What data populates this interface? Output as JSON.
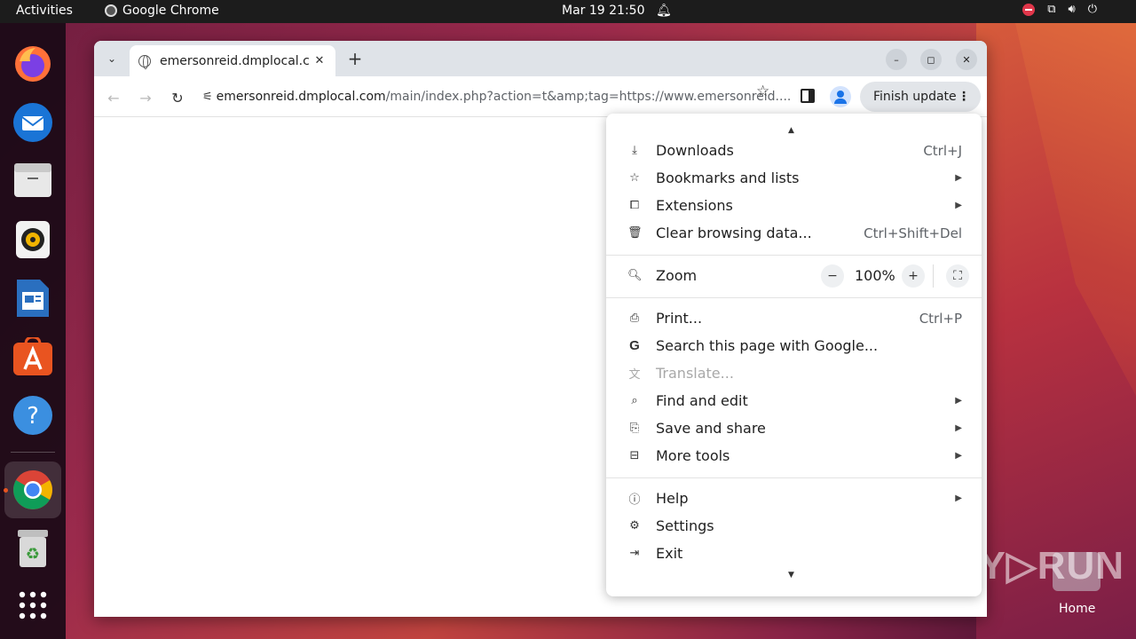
{
  "topbar": {
    "activities": "Activities",
    "app_name": "Google Chrome",
    "clock": "Mar 19  21:50"
  },
  "dock": {
    "items": [
      "firefox-icon",
      "thunderbird-icon",
      "files-icon",
      "rhythmbox-icon",
      "libreoffice-writer-icon",
      "app-center-icon",
      "help-icon",
      "chrome-icon",
      "trash-icon",
      "show-apps-icon"
    ]
  },
  "browser": {
    "tab_title": "emersonreid.dmplocal.c",
    "url_host": "emersonreid.dmplocal.com",
    "url_path": "/main/index.php?action=t&amp;tag=https://www.emersonreid....",
    "finish_update": "Finish update"
  },
  "menu": {
    "items": [
      {
        "icon": "download-icon",
        "label": "Downloads",
        "shortcut": "Ctrl+J"
      },
      {
        "icon": "star-icon",
        "label": "Bookmarks and lists",
        "submenu": true
      },
      {
        "icon": "extensions-icon",
        "label": "Extensions",
        "submenu": true
      },
      {
        "icon": "trash-icon",
        "label": "Clear browsing data...",
        "shortcut": "Ctrl+Shift+Del"
      }
    ],
    "zoom": {
      "label": "Zoom",
      "minus": "−",
      "value": "100%",
      "plus": "+"
    },
    "items2": [
      {
        "icon": "print-icon",
        "label": "Print...",
        "shortcut": "Ctrl+P"
      },
      {
        "icon": "google-icon",
        "label": "Search this page with Google..."
      },
      {
        "icon": "translate-icon",
        "label": "Translate...",
        "disabled": true
      },
      {
        "icon": "find-icon",
        "label": "Find and edit",
        "submenu": true
      },
      {
        "icon": "save-icon",
        "label": "Save and share",
        "submenu": true
      },
      {
        "icon": "toolbox-icon",
        "label": "More tools",
        "submenu": true
      }
    ],
    "items3": [
      {
        "icon": "help-icon",
        "label": "Help",
        "submenu": true
      },
      {
        "icon": "settings-icon",
        "label": "Settings"
      },
      {
        "icon": "exit-icon",
        "label": "Exit"
      }
    ]
  },
  "desktop": {
    "watermark": "ANY▷RUN",
    "home_label": "Home"
  }
}
